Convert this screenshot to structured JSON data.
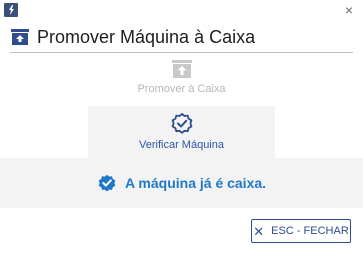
{
  "window": {
    "app_icon": "app-logo-icon",
    "close_glyph": "×"
  },
  "header": {
    "icon": "promote-box-icon",
    "title": "Promover Máquina à Caixa"
  },
  "steps": [
    {
      "label": "Promover à Caixa",
      "icon": "promote-box-icon",
      "state": "inactive"
    },
    {
      "label": "Verificar Máquina",
      "icon": "verified-badge-icon",
      "state": "active"
    }
  ],
  "result": {
    "icon": "check-badge-icon",
    "message": "A máquina já é caixa."
  },
  "footer": {
    "close_glyph": "✕",
    "close_label": "ESC - FECHAR"
  },
  "colors": {
    "accent": "#2f4c8f",
    "result_text": "#1f79c9",
    "inactive_text": "#b6b6b6",
    "band_bg": "#f3f3f3"
  }
}
